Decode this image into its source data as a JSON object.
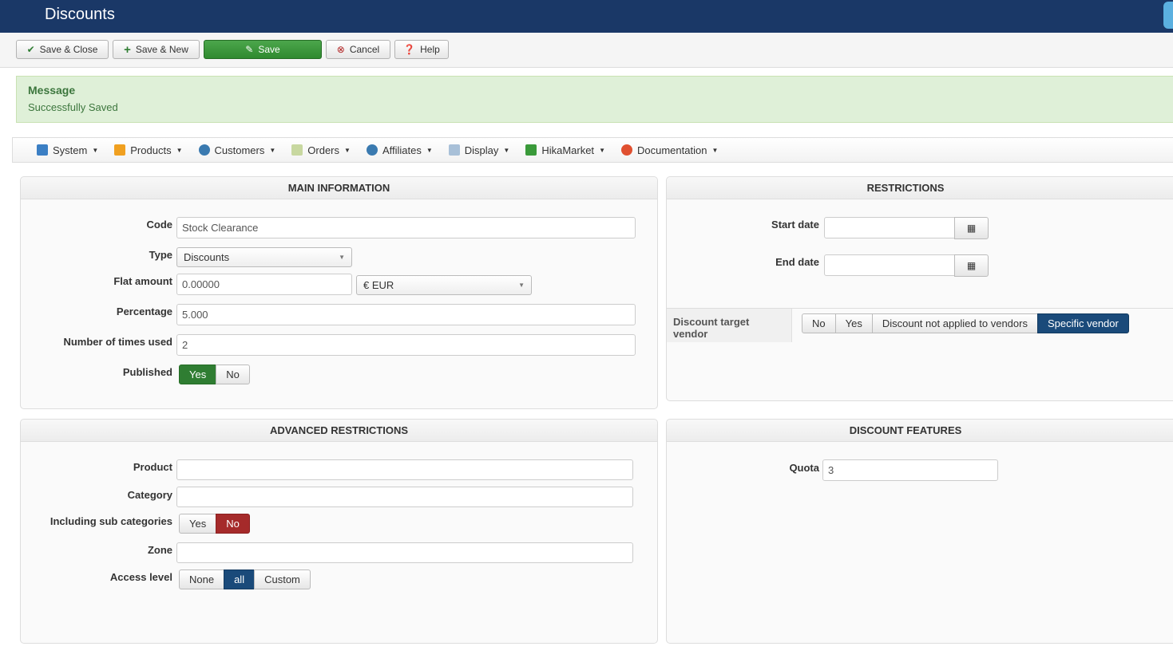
{
  "header": {
    "title": "Discounts"
  },
  "toolbar": {
    "save_close": "Save & Close",
    "save_new": "Save & New",
    "save": "Save",
    "cancel": "Cancel",
    "help": "Help"
  },
  "message": {
    "title": "Message",
    "text": "Successfully Saved"
  },
  "menu": [
    "System",
    "Products",
    "Customers",
    "Orders",
    "Affiliates",
    "Display",
    "HikaMarket",
    "Documentation"
  ],
  "main": {
    "title": "MAIN INFORMATION",
    "code_label": "Code",
    "code": "Stock Clearance",
    "type_label": "Type",
    "type": "Discounts",
    "flat_label": "Flat amount",
    "flat": "0.00000",
    "currency": "€ EUR",
    "pct_label": "Percentage",
    "pct": "5.000",
    "used_label": "Number of times used",
    "used": "2",
    "pub_label": "Published",
    "yes": "Yes",
    "no": "No"
  },
  "restrictions": {
    "title": "RESTRICTIONS",
    "start_label": "Start date",
    "end_label": "End date",
    "vendor_label": "Discount target vendor",
    "vendor_options": [
      "No",
      "Yes",
      "Discount not applied to vendors",
      "Specific vendor"
    ]
  },
  "advanced": {
    "title": "ADVANCED RESTRICTIONS",
    "product_label": "Product",
    "category_label": "Category",
    "sub_label": "Including sub categories",
    "yes": "Yes",
    "no": "No",
    "zone_label": "Zone",
    "access_label": "Access level",
    "access_options": [
      "None",
      "all",
      "Custom"
    ]
  },
  "features": {
    "title": "DISCOUNT FEATURES",
    "quota_label": "Quota",
    "quota": "3"
  }
}
